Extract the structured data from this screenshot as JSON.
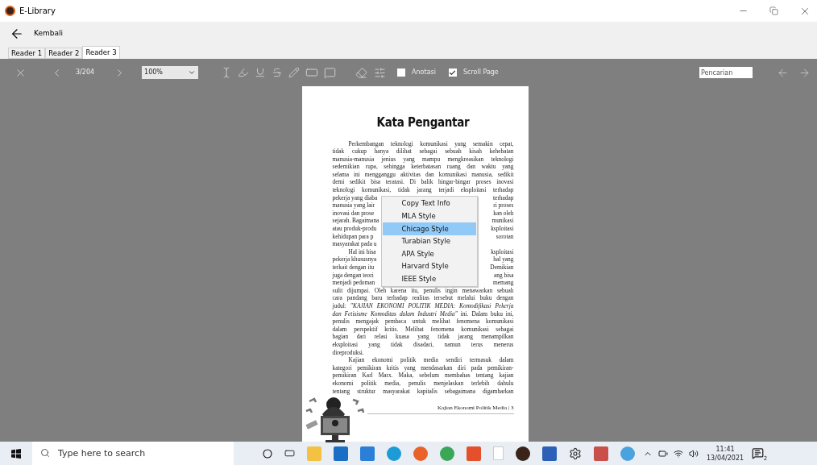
{
  "window": {
    "title": "E-Library"
  },
  "back": {
    "label": "Kembali"
  },
  "tabs": [
    {
      "label": "Reader 1",
      "selected": false
    },
    {
      "label": "Reader 2",
      "selected": false
    },
    {
      "label": "Reader 3",
      "selected": true
    }
  ],
  "toolbar": {
    "page": "3/204",
    "zoom": "100%",
    "checkboxes": [
      {
        "label": "Anotasi",
        "checked": false
      },
      {
        "label": "Scroll Page",
        "checked": true
      }
    ],
    "search": {
      "placeholder": "Pencarian"
    }
  },
  "document": {
    "title": "Kata Pengantar",
    "lines": [
      {
        "text": "Perkembangan teknologi komunikasi yang semakin cepat,",
        "indent": true
      },
      {
        "text": "tidak cukup hanya dilihat sebagai sebuah kisah kehebatan",
        "indent": false
      },
      {
        "text": "manusia-manusia jenius yang mampu mengkreasikan teknologi",
        "indent": false
      },
      {
        "text": "sedemikian rupa, sehingga keterbatasan ruang dan waktu yang",
        "indent": false
      },
      {
        "text": "selama ini mengganggu aktivitas dan komunikasi manusia, sedikit",
        "indent": false
      },
      {
        "text": "demi sedikit bisa teratasi. Di balik hingar-bingar proses inovasi",
        "indent": false
      },
      {
        "text": "teknologi komunikasi, tidak jarang terjadi eksploitasi terhadap",
        "indent": false
      },
      {
        "left": "pekerja yang diaba",
        "right": "terhadap",
        "indent": false
      },
      {
        "left": "manusia yang lair",
        "right": "ri proses",
        "indent": false
      },
      {
        "left": "inovasi dan prose",
        "right": "kan oleh",
        "indent": false
      },
      {
        "left": "sejarah. Bagaimana",
        "right": "munikasi",
        "indent": false
      },
      {
        "left": "atau produk-produ",
        "right": "ksploitasi",
        "indent": false
      },
      {
        "left": "kehidupan para p",
        "right": "sorotan",
        "indent": false
      },
      {
        "left": "masyarakat pada u",
        "indent": false
      },
      {
        "left": "Hal ini bisa",
        "right": "ksploitasi",
        "indent": true
      },
      {
        "left": "pekerja khususnya",
        "right": "hal yang",
        "indent": false
      },
      {
        "left": "terkait dengan itu",
        "right": "Demikian",
        "indent": false
      },
      {
        "left": "juga dengan teori",
        "right": "ang bisa",
        "indent": false
      },
      {
        "left": "menjadi pedoman",
        "right": "memang",
        "indent": false
      },
      {
        "text": "sulit dijumpai. Oleh karena itu, penulis ingin menawarkan sebuah",
        "indent": false
      },
      {
        "text": "cara pandang baru terhadap realitas tersebut melalui buku dengan",
        "indent": false
      },
      {
        "text": "judul: *\"KAJIAN EKONOMI POLITIK MEDIA: Komodifikasi Pekerja*",
        "indent": false
      },
      {
        "text": "*dan Fetisisme Komoditas dalam Industri Media\"* ini. Dalam buku ini,",
        "indent": false
      },
      {
        "text": "penulis mengajak pembaca untuk melihat fenomena komunikasi",
        "indent": false
      },
      {
        "text": "dalam perspektif kritis. Melihat fenomena komunikasi sebagai",
        "indent": false
      },
      {
        "text": "bagian dari relasi kuasa yang tidak jarang menampilkan",
        "indent": false
      },
      {
        "text": "eksploitasi yang tidak disadari, namun terus menerus",
        "indent": false
      },
      {
        "text": "direproduksi.",
        "indent": false
      },
      {
        "text": "Kajian ekonomi politik media sendiri termasuk dalam",
        "indent": true
      },
      {
        "text": "kategori pemikiran kritis yang mendasarkan diri pada pemikiran-",
        "indent": false
      },
      {
        "text": "pemikiran Karl Marx. Maka, sebelum membahas tentang kajian",
        "indent": false
      },
      {
        "text": "ekonomi politik media, penulis menjelaskan terlebih dahulu",
        "indent": false
      },
      {
        "text": "tentang struktur masyarakat kapitalis sebagaimana digambarkan",
        "indent": false
      }
    ],
    "footer": "Kajian Ekonomi Politik Media | 3"
  },
  "context_menu": [
    {
      "label": "Copy Text Info",
      "selected": false
    },
    {
      "label": "MLA Style",
      "selected": false
    },
    {
      "label": "Chicago Style",
      "selected": true
    },
    {
      "label": "Turabian Style",
      "selected": false
    },
    {
      "label": "APA Style",
      "selected": false
    },
    {
      "label": "Harvard Style",
      "selected": false
    },
    {
      "label": "IEEE Style",
      "selected": false
    }
  ],
  "taskbar": {
    "search": {
      "placeholder": "Type here to search"
    },
    "time": "11:41",
    "date": "13/04/2021",
    "notifications": "2"
  }
}
